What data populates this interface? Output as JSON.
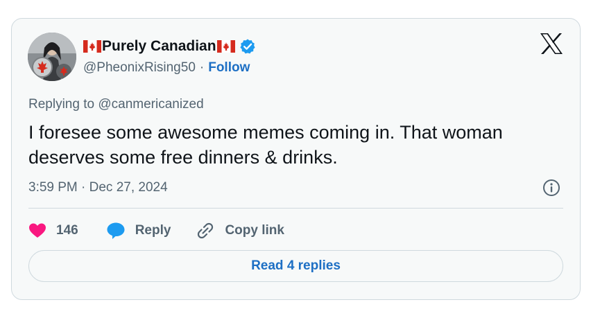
{
  "author": {
    "display_name": "Purely Canadian",
    "handle": "@PheonixRising50",
    "separator": "·",
    "follow_label": "Follow",
    "verified": true
  },
  "tweet": {
    "replying_to": "Replying to @canmericanized",
    "text": "I foresee some awesome memes coming in. That woman deserves some free dinners & drinks.",
    "timestamp": "3:59 PM · Dec 27, 2024"
  },
  "actions": {
    "like_count": "146",
    "reply_label": "Reply",
    "copy_link_label": "Copy link"
  },
  "read_replies_label": "Read 4 replies",
  "colors": {
    "accent": "#1d6fc4",
    "like": "#f91880",
    "verified": "#1d9bf0",
    "flag_red": "#d52b1e"
  },
  "icons": {
    "brand": "x-logo-icon",
    "verified": "verified-badge-icon",
    "info": "info-icon",
    "like": "heart-icon",
    "reply": "speech-bubble-icon",
    "copy_link": "link-icon"
  }
}
